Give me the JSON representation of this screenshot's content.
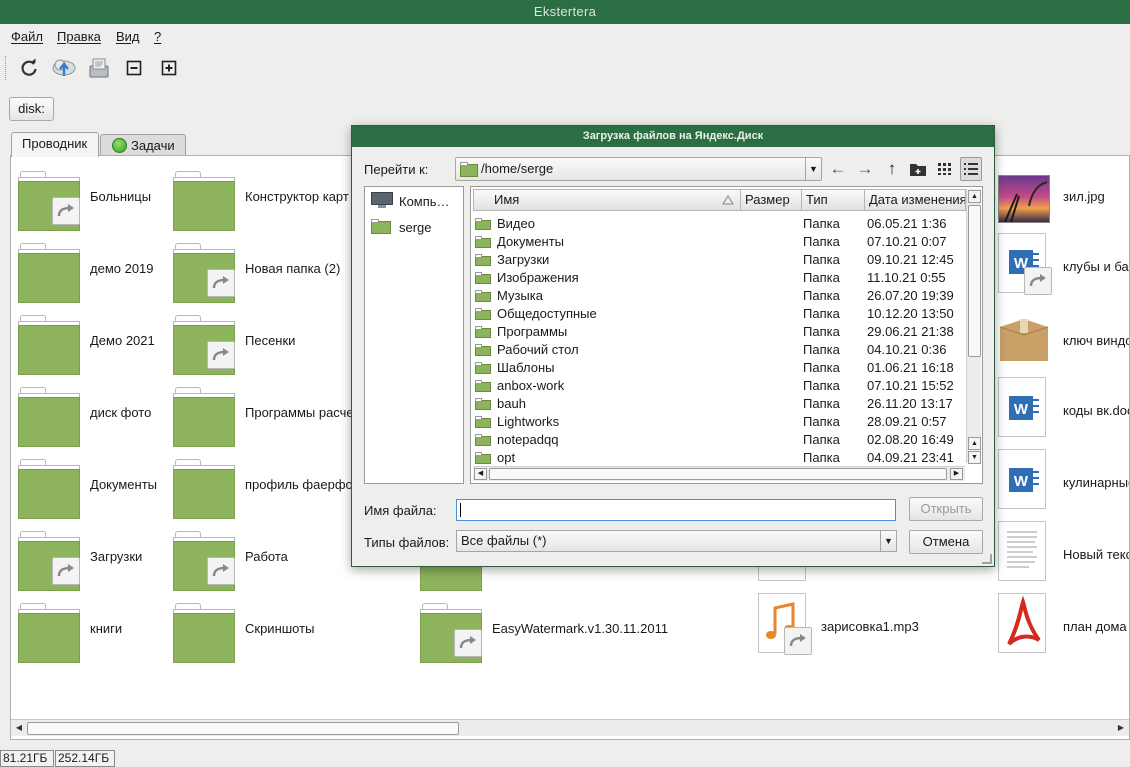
{
  "app": {
    "title": "Ekstertera"
  },
  "menu": [
    {
      "label": "Файл"
    },
    {
      "label": "Правка"
    },
    {
      "label": "Вид"
    },
    {
      "label": "?"
    }
  ],
  "toolbar": {
    "icons": [
      "refresh-icon",
      "upload-cloud-icon",
      "download-icon",
      "collapse-icon",
      "expand-icon"
    ]
  },
  "disk_button": {
    "label": "disk:"
  },
  "tabs": [
    {
      "label": "Проводник",
      "active": true
    },
    {
      "label": "Задачи",
      "active": false
    }
  ],
  "items": [
    {
      "label": "Больницы",
      "kind": "folder",
      "link": true
    },
    {
      "label": "демо 2019",
      "kind": "folder",
      "link": false
    },
    {
      "label": "Демо 2021",
      "kind": "folder",
      "link": false
    },
    {
      "label": "диск фото",
      "kind": "folder",
      "link": false
    },
    {
      "label": "Документы",
      "kind": "folder",
      "link": false
    },
    {
      "label": "Загрузки",
      "kind": "folder",
      "link": true
    },
    {
      "label": "книги",
      "kind": "folder",
      "link": false
    },
    {
      "label": "Конструктор карт",
      "kind": "folder",
      "link": false
    },
    {
      "label": "Новая папка (2)",
      "kind": "folder",
      "link": true
    },
    {
      "label": "Песенки",
      "kind": "folder",
      "link": true
    },
    {
      "label": "Программы расче",
      "kind": "folder",
      "link": false
    },
    {
      "label": "профиль фаерфо",
      "kind": "folder",
      "link": false
    },
    {
      "label": "Работа",
      "kind": "folder",
      "link": true
    },
    {
      "label": "Скриншоты",
      "kind": "folder",
      "link": false
    },
    {
      "label": "EasyWatermark.v1.30.11.2011",
      "kind": "folder",
      "link": true
    },
    {
      "label": "зарисовка1.mp3",
      "kind": "audio",
      "link": true
    },
    {
      "label": "зил.jpg",
      "kind": "image",
      "link": false
    },
    {
      "label": "клубы и бар",
      "kind": "word",
      "link": true
    },
    {
      "label": "ключ виндо",
      "kind": "box",
      "link": false
    },
    {
      "label": "коды вк.doc",
      "kind": "word",
      "link": false
    },
    {
      "label": "кулинарные",
      "kind": "word",
      "link": false
    },
    {
      "label": "Новый текс",
      "kind": "text",
      "link": false
    },
    {
      "label": "план дома",
      "kind": "pdf",
      "link": false
    }
  ],
  "status": {
    "free": "81.21ГБ",
    "total": "252.14ГБ"
  },
  "dialog": {
    "title": "Загрузка файлов на Яндекс.Диск",
    "goto_label": "Перейти к:",
    "path": "/home/serge",
    "places": [
      {
        "label": "Компь…"
      },
      {
        "label": "serge"
      }
    ],
    "columns": {
      "name": "Имя",
      "size": "Размер",
      "type": "Тип",
      "date": "Дата изменения"
    },
    "files": [
      {
        "name": "Видео",
        "type": "Папка",
        "date": "06.05.21 1:36"
      },
      {
        "name": "Документы",
        "type": "Папка",
        "date": "07.10.21 0:07"
      },
      {
        "name": "Загрузки",
        "type": "Папка",
        "date": "09.10.21 12:45"
      },
      {
        "name": "Изображения",
        "type": "Папка",
        "date": "11.10.21 0:55"
      },
      {
        "name": "Музыка",
        "type": "Папка",
        "date": "26.07.20 19:39"
      },
      {
        "name": "Общедоступные",
        "type": "Папка",
        "date": "10.12.20 13:50"
      },
      {
        "name": "Программы",
        "type": "Папка",
        "date": "29.06.21 21:38"
      },
      {
        "name": "Рабочий стол",
        "type": "Папка",
        "date": "04.10.21 0:36"
      },
      {
        "name": "Шаблоны",
        "type": "Папка",
        "date": "01.06.21 16:18"
      },
      {
        "name": "anbox-work",
        "type": "Папка",
        "date": "07.10.21 15:52"
      },
      {
        "name": "bauh",
        "type": "Папка",
        "date": "26.11.20 13:17"
      },
      {
        "name": "Lightworks",
        "type": "Папка",
        "date": "28.09.21 0:57"
      },
      {
        "name": "notepadqq",
        "type": "Папка",
        "date": "02.08.20 16:49"
      },
      {
        "name": "opt",
        "type": "Папка",
        "date": "04.09.21 23:41"
      }
    ],
    "filename_label": "Имя файла:",
    "filename_value": "",
    "open_button": "Открыть",
    "filetypes_label": "Типы файлов:",
    "filetypes_value": "Все файлы (*)",
    "cancel_button": "Отмена"
  },
  "colors": {
    "titlebar": "#2b6e43",
    "folder": "#8db35c",
    "word": "#2f6db5",
    "pdf": "#d42a20",
    "audio": "#e8862a"
  }
}
